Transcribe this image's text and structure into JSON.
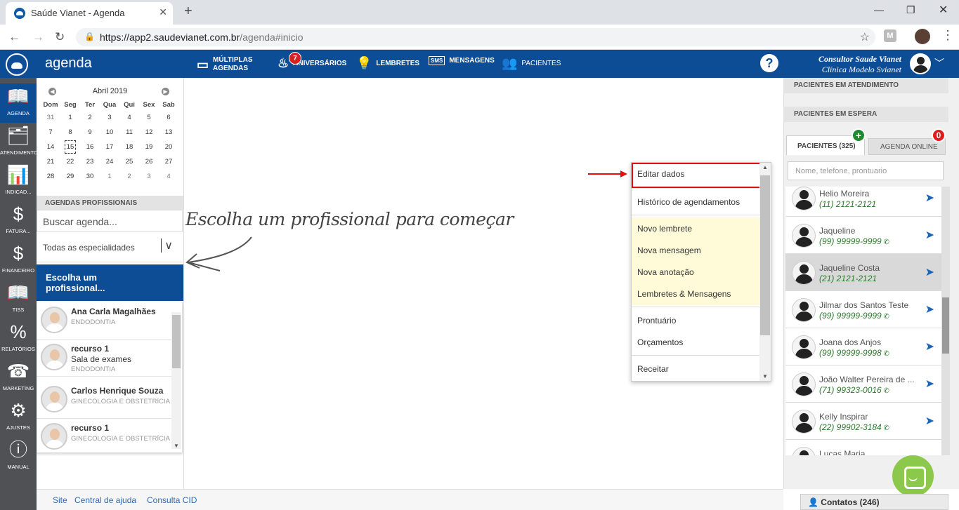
{
  "browser": {
    "tab_title": "Saúde Vianet - Agenda",
    "url_main": "https://app2.saudevianet.com.br",
    "url_path": "/agenda#inicio",
    "ext_label": "M"
  },
  "header": {
    "app_title": "agenda",
    "nav": [
      {
        "label": "MÚLTIPLAS",
        "label2": "AGENDAS"
      },
      {
        "label": "ANIVERSÁRIOS",
        "badge": "7"
      },
      {
        "label": "LEMBRETES"
      },
      {
        "label": "MENSAGENS",
        "icon_text": "SMS"
      },
      {
        "label": "PACIENTES"
      }
    ],
    "help": "?",
    "user_name": "Consultor Saude Vianet",
    "clinic": "Clínica Modelo Svianet"
  },
  "sidebar": {
    "items": [
      {
        "label": "AGENDA",
        "icon": "calendar-book-icon"
      },
      {
        "label": "ATENDIMENTO",
        "icon": "folder-check-icon"
      },
      {
        "label": "INDICAD...",
        "icon": "bar-chart-icon"
      },
      {
        "label": "FATURA...",
        "icon": "dollar-doc-icon"
      },
      {
        "label": "FINANCEIRO",
        "icon": "dollar-doc-icon"
      },
      {
        "label": "TISS",
        "icon": "book-icon"
      },
      {
        "label": "RELATÓRIOS",
        "icon": "percent-doc-icon"
      },
      {
        "label": "MARKETING",
        "icon": "phone-icon"
      },
      {
        "label": "AJUSTES",
        "icon": "gears-icon"
      },
      {
        "label": "MANUAL",
        "icon": "manual-icon"
      }
    ]
  },
  "calendar": {
    "month": "Abril 2019",
    "weekdays": [
      "Dom",
      "Seg",
      "Ter",
      "Qua",
      "Qui",
      "Sex",
      "Sab"
    ],
    "weeks": [
      [
        "31",
        "1",
        "2",
        "3",
        "4",
        "5",
        "6"
      ],
      [
        "7",
        "8",
        "9",
        "10",
        "11",
        "12",
        "13"
      ],
      [
        "14",
        "15",
        "16",
        "17",
        "18",
        "19",
        "20"
      ],
      [
        "21",
        "22",
        "23",
        "24",
        "25",
        "26",
        "27"
      ],
      [
        "28",
        "29",
        "30",
        "1",
        "2",
        "3",
        "4"
      ]
    ],
    "today": "15"
  },
  "agendas": {
    "header": "AGENDAS PROFISSIONAIS",
    "search_placeholder": "Buscar agenda...",
    "specialty": "Todas as especialidades",
    "choose_line1": "Escolha um",
    "choose_line2": "profissional...",
    "professionals": [
      {
        "name": "Ana Carla Magalhães",
        "sub": "",
        "specialty": "ENDODONTIA"
      },
      {
        "name": "recurso 1",
        "sub": "Sala de exames",
        "specialty": "ENDODONTIA"
      },
      {
        "name": "Carlos Henrique Souza",
        "sub": "",
        "specialty": "GINECOLOGIA E OBSTETRÍCIA"
      },
      {
        "name": "recurso 1",
        "sub": "",
        "specialty": "GINECOLOGIA E OBSTETRÍCIA"
      }
    ]
  },
  "main": {
    "hint": "Escolha um profissional para começar"
  },
  "context_menu": {
    "items": [
      "Editar dados",
      "Histórico de agendamentos",
      "Novo lembrete",
      "Nova mensagem",
      "Nova anotação",
      "Lembretes & Mensagens",
      "Prontuário",
      "Orçamentos",
      "Receitar"
    ]
  },
  "right_panel": {
    "in_service": "PACIENTES EM ATENDIMENTO",
    "waiting": "PACIENTES EM ESPERA",
    "tab_patients": "PACIENTES (325)",
    "tab_online": "AGENDA ONLINE",
    "online_badge": "0",
    "search_placeholder": "Nome, telefone, prontuario",
    "patients": [
      {
        "name": "Helio Moreira",
        "phone": "(11) 2121-2121",
        "whatsapp": false
      },
      {
        "name": "Jaqueline",
        "phone": "(99) 99999-9999",
        "whatsapp": true
      },
      {
        "name": "Jaqueline Costa",
        "phone": "(21) 2121-2121",
        "whatsapp": false
      },
      {
        "name": "Jilmar dos Santos Teste",
        "phone": "(99) 99999-9999",
        "whatsapp": true
      },
      {
        "name": "Joana dos Anjos",
        "phone": "(99) 99999-9998",
        "whatsapp": true
      },
      {
        "name": "João Walter Pereira de ...",
        "phone": "(71) 99323-0016",
        "whatsapp": true
      },
      {
        "name": "Kelly Inspirar",
        "phone": "(22) 99902-3184",
        "whatsapp": true
      },
      {
        "name": "Lucas Maria",
        "phone": "",
        "whatsapp": false
      }
    ],
    "contacts": "Contatos (246)"
  },
  "footer": {
    "links": [
      "Site",
      "Central de ajuda",
      "Consulta CID"
    ]
  },
  "colors": {
    "brand_blue": "#0d4d96",
    "highlight_red": "#dd1111",
    "menu_yellow": "#fffbd8",
    "chat_green": "#8cc84b"
  }
}
